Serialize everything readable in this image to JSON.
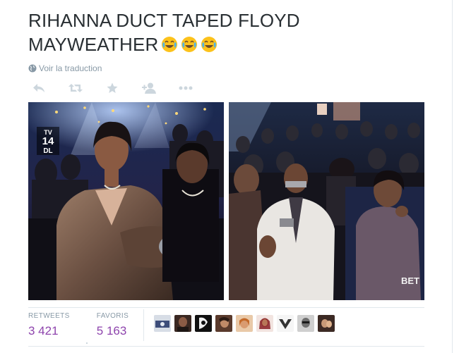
{
  "tweet": {
    "line1": "RIHANNA DUCT TAPED FLOYD",
    "line2": "MAYWEATHER",
    "emoji": [
      "face-with-tears-of-joy",
      "face-with-tears-of-joy",
      "face-with-tears-of-joy"
    ]
  },
  "translate_link": "Voir la traduction",
  "actions": [
    "reply-icon",
    "retweet-icon",
    "favorite-icon",
    "follow-icon",
    "more-icon"
  ],
  "media": {
    "left_overlay": {
      "channel_tv": "TV",
      "channel_num": "14",
      "channel_rating": "DL"
    },
    "right_overlay": {
      "network_logo": "BET"
    }
  },
  "stats": {
    "retweets_label": "RETWEETS",
    "retweets_value": "3 421",
    "favorites_label": "FAVORIS",
    "favorites_value": "5 163"
  },
  "avatar_count": 9,
  "colors": {
    "text": "#292f33",
    "muted": "#8899a6",
    "accent": "#8e44ad",
    "divider": "#e1e8ed"
  }
}
